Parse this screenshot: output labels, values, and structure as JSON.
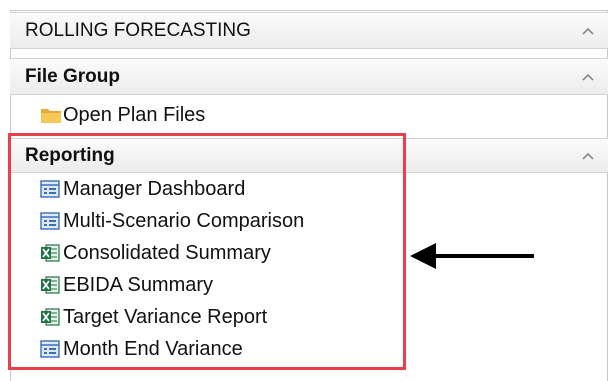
{
  "sections": {
    "rolling_forecasting": {
      "title": "ROLLING FORECASTING"
    },
    "file_group": {
      "title": "File Group",
      "items": [
        {
          "label": "Open Plan Files",
          "icon": "folder-icon"
        }
      ]
    },
    "reporting": {
      "title": "Reporting",
      "items": [
        {
          "label": "Manager Dashboard",
          "icon": "report-icon"
        },
        {
          "label": "Multi-Scenario Comparison",
          "icon": "report-icon"
        },
        {
          "label": "Consolidated Summary",
          "icon": "excel-icon"
        },
        {
          "label": "EBIDA Summary",
          "icon": "excel-icon"
        },
        {
          "label": "Target Variance Report",
          "icon": "excel-icon"
        },
        {
          "label": "Month End Variance",
          "icon": "report-icon"
        }
      ]
    }
  },
  "colors": {
    "highlight_box": "#e8404a",
    "excel_green": "#217346",
    "report_blue": "#3b6fb6",
    "folder_yellow": "#f2c14e"
  }
}
